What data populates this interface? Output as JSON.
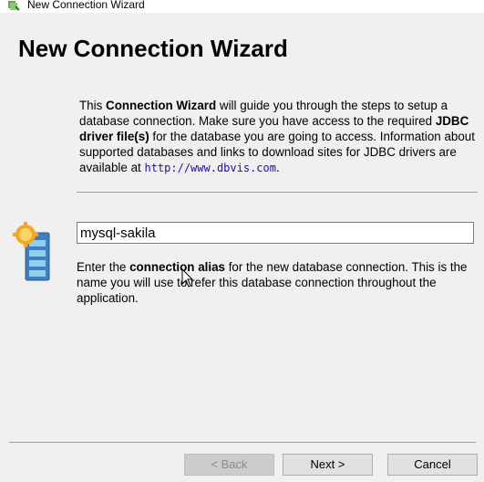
{
  "window": {
    "title": "New Connection Wizard"
  },
  "page": {
    "heading": "New Connection Wizard"
  },
  "intro": {
    "p1": "This ",
    "b1": "Connection Wizard",
    "p2": " will guide you through the steps to setup a database connection. Make sure you have access to the required ",
    "b2": "JDBC driver file(s)",
    "p3": " for the database you are going to access. Information about supported databases and links to download sites for JDBC drivers are available at ",
    "link": "http://www.dbvis.com",
    "p4": "."
  },
  "alias": {
    "value": "mysql-sakila",
    "desc_p1": "Enter the ",
    "desc_b": "connection alias",
    "desc_p2": " for the new database connection. This is the name you will use to refer this database connection throughout the application."
  },
  "buttons": {
    "back": "< Back",
    "next": "Next >",
    "cancel": "Cancel"
  },
  "icons": {
    "title": "dbvis-logo-icon",
    "database": "database-server-icon"
  },
  "colors": {
    "link": "#1a0dab",
    "gear": "#f5a623",
    "server": "#4a90c8"
  }
}
